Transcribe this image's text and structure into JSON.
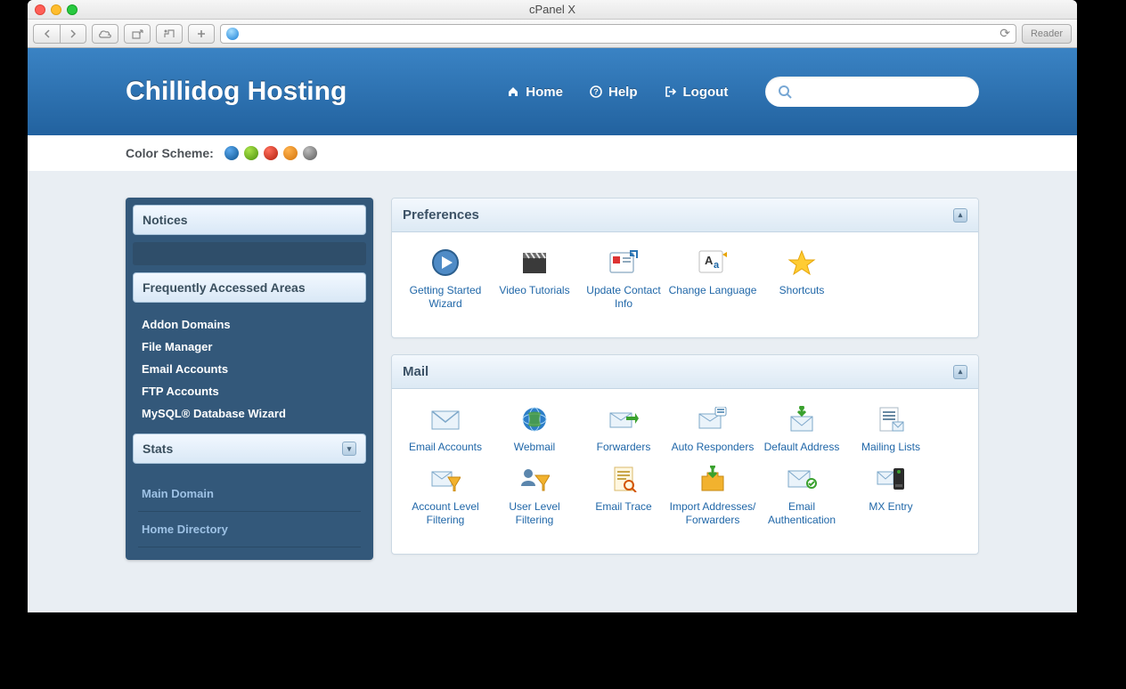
{
  "window": {
    "title": "cPanel X",
    "reader": "Reader"
  },
  "header": {
    "brand": "Chillidog Hosting",
    "nav": {
      "home": "Home",
      "help": "Help",
      "logout": "Logout"
    },
    "search_placeholder": ""
  },
  "scheme": {
    "label": "Color Scheme:"
  },
  "sidebar": {
    "notices": "Notices",
    "freq_title": "Frequently Accessed Areas",
    "freq_items": [
      "Addon Domains",
      "File Manager",
      "Email Accounts",
      "FTP Accounts",
      "MySQL® Database Wizard"
    ],
    "stats_title": "Stats",
    "stats_items": [
      "Main Domain",
      "Home Directory"
    ]
  },
  "panels": {
    "preferences": {
      "title": "Preferences",
      "items": [
        "Getting Started Wizard",
        "Video Tutorials",
        "Update Contact Info",
        "Change Language",
        "Shortcuts"
      ]
    },
    "mail": {
      "title": "Mail",
      "items": [
        "Email Accounts",
        "Webmail",
        "Forwarders",
        "Auto Responders",
        "Default Address",
        "Mailing Lists",
        "Account Level Filtering",
        "User Level Filtering",
        "Email Trace",
        "Import Addresses/ Forwarders",
        "Email Authentication",
        "MX Entry"
      ]
    }
  }
}
